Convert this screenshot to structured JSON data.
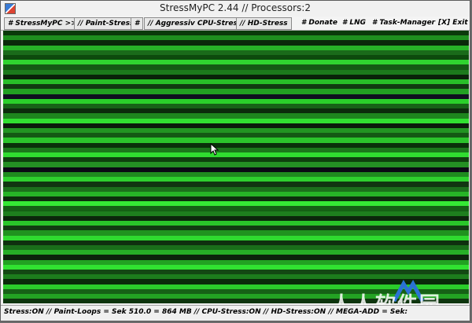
{
  "window": {
    "title": "StressMyPC 2.44 // Processors:2"
  },
  "menu": {
    "items": [
      {
        "label": "# StressMyPC >>",
        "boxed": true
      },
      {
        "label": "// Paint-Stress",
        "boxed": true
      },
      {
        "label": "#",
        "boxed": true
      },
      {
        "label": "// Aggressiv CPU-Stress",
        "boxed": true
      },
      {
        "label": "// HD-Stress",
        "boxed": true
      },
      {
        "label": "# Donate",
        "boxed": false
      },
      {
        "label": "# LNG",
        "boxed": false
      },
      {
        "label": "# Task-Manager",
        "boxed": false
      },
      {
        "label": "[X] Exit",
        "boxed": false
      }
    ]
  },
  "status": {
    "text": "Stress:ON // Paint-Loops = Sek 510.0 = 864 MB // CPU-Stress:ON // HD-Stress:ON // MEGA-ADD = Sek:"
  },
  "watermark": {
    "text": "人人软件园"
  },
  "colors": {
    "stripes": [
      "#0b3a0b",
      "#1f8f1f",
      "#0a2a0a",
      "#27b327",
      "#1a6b1a",
      "#0d4a0d",
      "#2fd42f",
      "#145a14",
      "#1c7a1c",
      "#0a220a",
      "#28bf28",
      "#113a11",
      "#22a022",
      "#0f0f1f",
      "#2ad02a",
      "#176217",
      "#0c2c0c",
      "#1e861e",
      "#31e031",
      "#0b1a0b",
      "#229522",
      "#145914",
      "#2bc42b",
      "#0a2f0a",
      "#1b781b",
      "#30dd30",
      "#0e3f0e",
      "#248f24",
      "#0a0a14",
      "#1f8a1f",
      "#2ed02e",
      "#113511",
      "#1c701c",
      "#27b427",
      "#0d2e0d",
      "#35e835",
      "#156015",
      "#1e7e1e",
      "#0b260b",
      "#2ac62a",
      "#123c12",
      "#20921f",
      "#2fd92f",
      "#0f300f",
      "#1a6e1a",
      "#27ae27",
      "#0c240c",
      "#22a222",
      "#31e231",
      "#134813",
      "#1d7d1d",
      "#0a2a0a",
      "#2bcc2b",
      "#166116",
      "#23a223",
      "#0e350e"
    ]
  }
}
